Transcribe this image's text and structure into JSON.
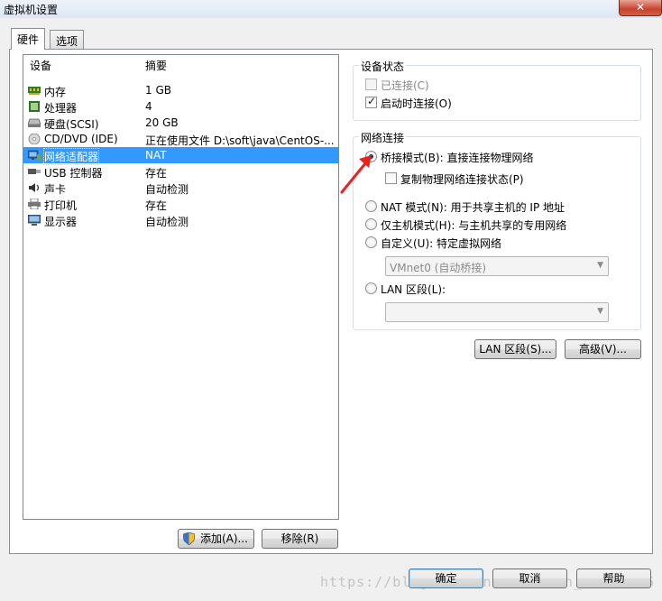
{
  "window": {
    "title": "虚拟机设置",
    "close_glyph": "✕"
  },
  "tabs": [
    {
      "label": "硬件"
    },
    {
      "label": "选项"
    }
  ],
  "device_list": {
    "columns": {
      "device": "设备",
      "summary": "摘要"
    },
    "rows": [
      {
        "name": "内存",
        "summary": "1 GB",
        "icon": "memory-icon"
      },
      {
        "name": "处理器",
        "summary": "4",
        "icon": "processor-icon"
      },
      {
        "name": "硬盘(SCSI)",
        "summary": "20 GB",
        "icon": "hard-disk-icon"
      },
      {
        "name": "CD/DVD (IDE)",
        "summary": "正在使用文件 D:\\soft\\java\\CentOS-...",
        "icon": "cd-dvd-icon"
      },
      {
        "name": "网络适配器",
        "summary": "NAT",
        "icon": "network-adapter-icon"
      },
      {
        "name": "USB 控制器",
        "summary": "存在",
        "icon": "usb-icon"
      },
      {
        "name": "声卡",
        "summary": "自动检测",
        "icon": "sound-card-icon"
      },
      {
        "name": "打印机",
        "summary": "存在",
        "icon": "printer-icon"
      },
      {
        "name": "显示器",
        "summary": "自动检测",
        "icon": "display-icon"
      }
    ],
    "selected_index": 4
  },
  "device_status": {
    "title": "设备状态",
    "connected": {
      "label": "已连接(C)",
      "checked": false,
      "enabled": false
    },
    "connect_at_power_on": {
      "label": "启动时连接(O)",
      "checked": true
    }
  },
  "network_connection": {
    "title": "网络连接",
    "bridged": {
      "label": "桥接模式(B): 直接连接物理网络",
      "selected": true
    },
    "replicate": {
      "label": "复制物理网络连接状态(P)",
      "checked": false
    },
    "nat": {
      "label": "NAT 模式(N): 用于共享主机的 IP 地址",
      "selected": false
    },
    "host_only": {
      "label": "仅主机模式(H): 与主机共享的专用网络",
      "selected": false
    },
    "custom": {
      "label": "自定义(U): 特定虚拟网络",
      "selected": false
    },
    "custom_select": {
      "value": "VMnet0 (自动桥接)"
    },
    "lan_segment": {
      "label": "LAN 区段(L):",
      "selected": false
    },
    "lan_select": {
      "value": ""
    }
  },
  "buttons": {
    "lan_segments": "LAN 区段(S)...",
    "advanced": "高级(V)...",
    "add": "添加(A)...",
    "remove": "移除(R)",
    "ok": "确定",
    "cancel": "取消",
    "help": "帮助"
  },
  "watermark": "https://blog.csdn.net/weixin_40844285",
  "colors": {
    "selection": "#3399ff",
    "annotation_arrow": "#e8231d"
  }
}
